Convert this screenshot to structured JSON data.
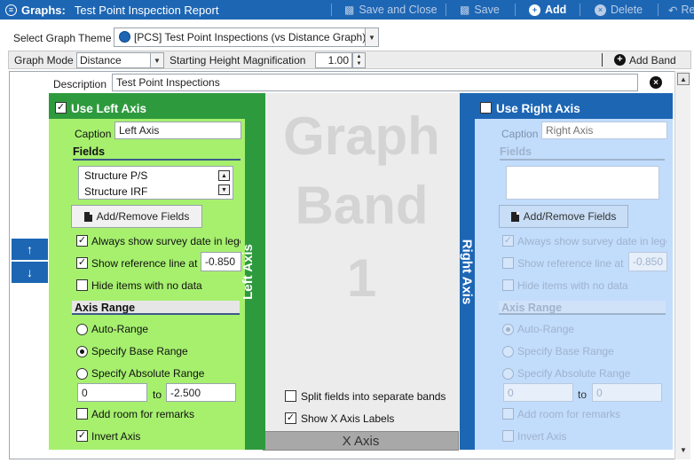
{
  "titlebar": {
    "app": "Graphs:",
    "report": "Test Point Inspection Report",
    "save_close": "Save and Close",
    "save": "Save",
    "add": "Add",
    "delete": "Delete",
    "extra": "Re"
  },
  "theme": {
    "label": "Select Graph Theme",
    "value": "[PCS] Test Point Inspections (vs Distance Graph)"
  },
  "mode": {
    "label": "Graph Mode",
    "value": "Distance",
    "mag_label": "Starting Height Magnification",
    "mag_value": "1.00",
    "add_band": "Add Band"
  },
  "band": {
    "description_label": "Description",
    "description_value": "Test Point Inspections",
    "graph_text": [
      "Graph",
      "Band",
      "1"
    ],
    "split_fields": "Split fields into separate bands",
    "show_x_labels": "Show X Axis Labels",
    "x_axis": "X Axis"
  },
  "left": {
    "use_axis": "Use Left Axis",
    "vertical_label": "Left Axis",
    "caption_label": "Caption",
    "caption_value": "Left Axis",
    "fields_label": "Fields",
    "fields": [
      "Structure P/S",
      "Structure IRF"
    ],
    "add_remove": "Add/Remove Fields",
    "always_show": "Always show survey date in lege",
    "show_ref": "Show reference line at",
    "ref_value": "-0.850",
    "hide_items": "Hide items with no data",
    "axis_range": "Axis Range",
    "auto_range": "Auto-Range",
    "base_range": "Specify Base Range",
    "abs_range": "Specify Absolute Range",
    "range_from": "0",
    "to": "to",
    "range_to": "-2.500",
    "add_room": "Add room for remarks",
    "invert": "Invert Axis"
  },
  "right": {
    "use_axis": "Use Right Axis",
    "vertical_label": "Right Axis",
    "caption_label": "Caption",
    "caption_placeholder": "Right Axis",
    "fields_label": "Fields",
    "add_remove": "Add/Remove Fields",
    "always_show": "Always show survey date in lege",
    "show_ref": "Show reference line at",
    "ref_value": "-0.850",
    "hide_items": "Hide items with no data",
    "axis_range": "Axis Range",
    "auto_range": "Auto-Range",
    "base_range": "Specify Base Range",
    "abs_range": "Specify Absolute Range",
    "range_from": "0",
    "to": "to",
    "range_to": "0",
    "add_room": "Add room for remarks",
    "invert": "Invert Axis"
  },
  "colors": {
    "titlebar": "#1d66b4",
    "left_panel": "#2e9a3e",
    "left_inner": "#a6f06e",
    "right_panel": "#1d66b4",
    "right_inner": "#c2dcfc"
  },
  "icons": {
    "graphs": "circle-chevron-icon",
    "save": "floppy-icon",
    "add": "plus-circle-icon",
    "delete": "x-circle-icon",
    "redo": "undo-arrow-icon",
    "globe": "globe-icon",
    "close": "close-circle-icon",
    "file": "file-icon"
  }
}
